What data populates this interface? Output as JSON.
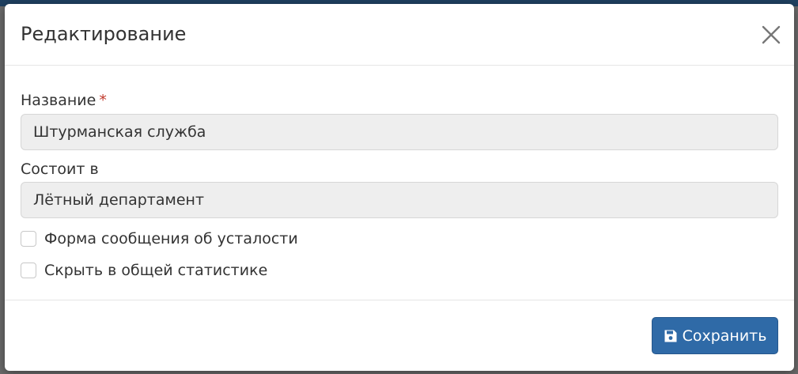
{
  "modal": {
    "title": "Редактирование",
    "close_icon": "close-icon"
  },
  "form": {
    "name_label": "Название",
    "name_required_mark": "*",
    "name_value": "Штурманская служба",
    "parent_label": "Состоит в",
    "parent_value": "Лётный департамент",
    "checkboxes": [
      {
        "label": "Форма сообщения об усталости",
        "checked": false
      },
      {
        "label": "Скрыть в общей статистике",
        "checked": false
      }
    ]
  },
  "footer": {
    "save_label": "Сохранить",
    "save_icon": "floppy-disk-icon"
  },
  "colors": {
    "primary": "#2f6aa7",
    "required": "#c0392b",
    "field_bg": "#eeeeee"
  }
}
